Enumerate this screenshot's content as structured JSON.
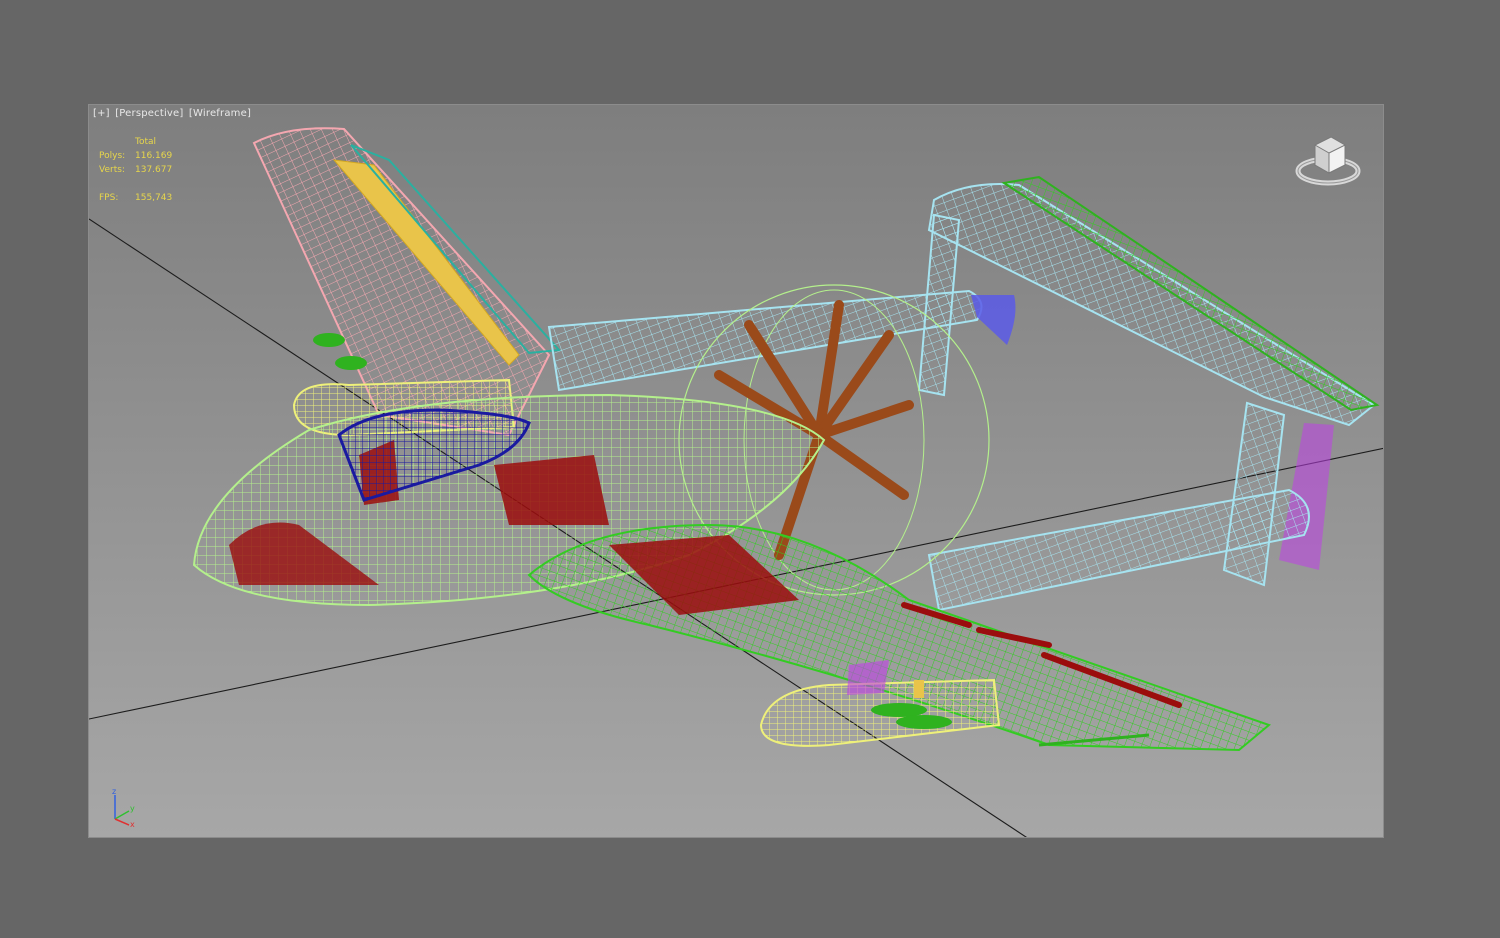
{
  "viewport": {
    "label_plus": "[+]",
    "label_view": "[Perspective]",
    "label_shading": "[Wireframe]"
  },
  "stats": {
    "total_label": "Total",
    "polys_label": "Polys:",
    "polys_value": "116.169",
    "verts_label": "Verts:",
    "verts_value": "137.677",
    "fps_label": "FPS:",
    "fps_value": "155,743"
  },
  "icons": {
    "viewcube": "viewcube-icon",
    "axis": "axis-tripod-icon"
  },
  "axis_labels": {
    "z": "z",
    "y": "y",
    "x": "x"
  },
  "colors": {
    "viewport_bg_top": "#7e7e7e",
    "stats_text": "#e7d64b",
    "fuselage": "#b4f08c",
    "canopy": "#1a1aa0",
    "left_wing": "#f4a7b0",
    "right_wing": "#33cc22",
    "tail_boom": "#a6e3f0",
    "propeller": "#9a4a1a",
    "internals": "#9b0d0d",
    "pods": "#eef07a",
    "accent_purple": "#c040e8",
    "accent_blue": "#5a5ae8"
  }
}
